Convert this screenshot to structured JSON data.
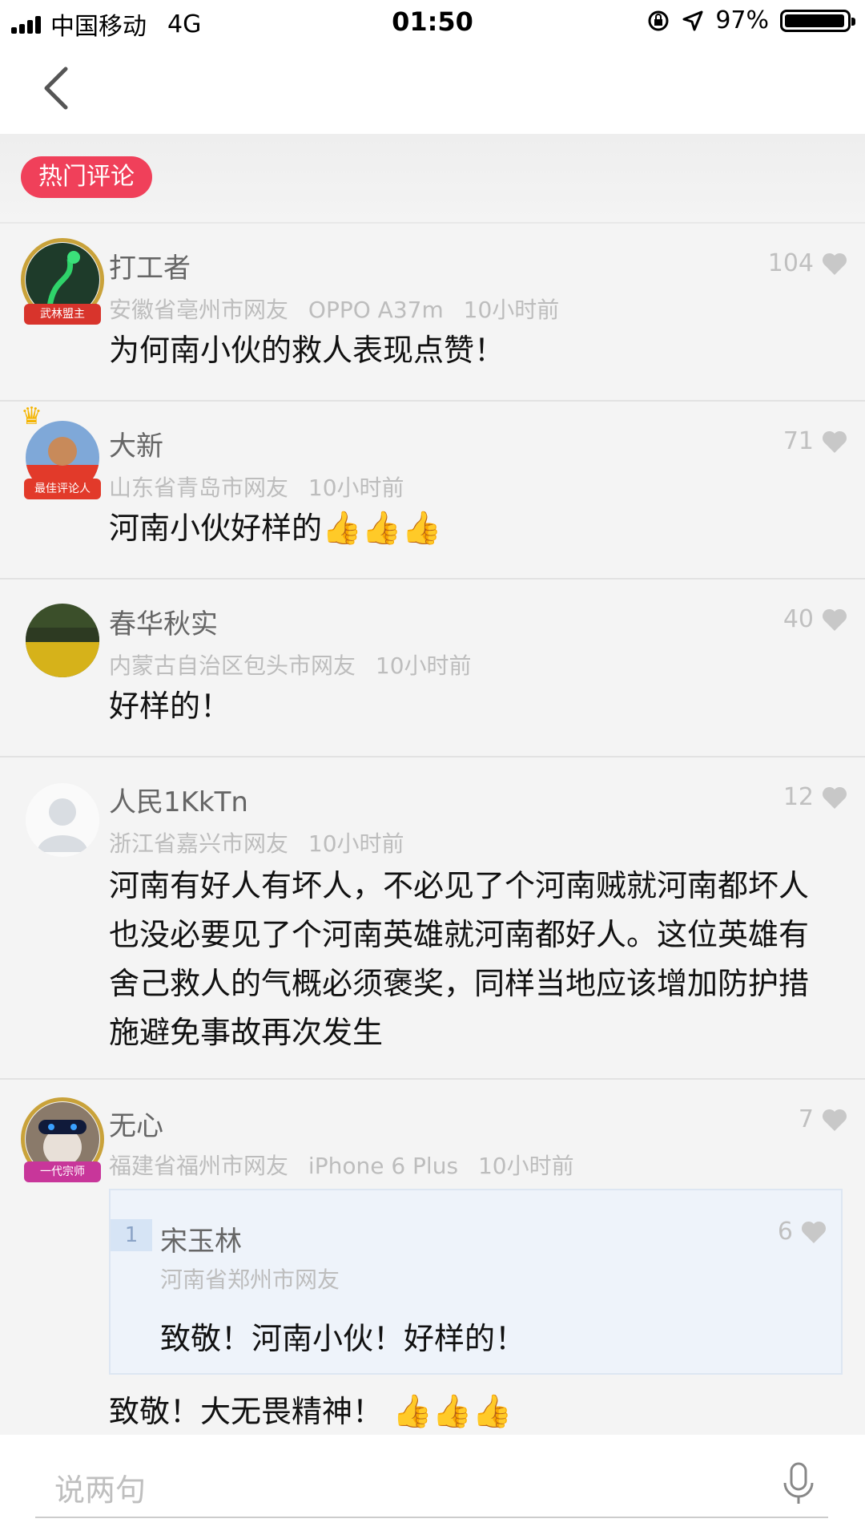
{
  "status_bar": {
    "carrier": "中国移动",
    "network": "4G",
    "time": "01:50",
    "battery": "97%",
    "battery_level": 0.97
  },
  "section": {
    "hot_label": "热门评论"
  },
  "comments": [
    {
      "name": "打工者",
      "location": "安徽省亳州市网友",
      "device": "OPPO A37m",
      "time": "10小时前",
      "likes": "104",
      "text": "为何南小伙的救人表现点赞！",
      "badge": "武林盟主"
    },
    {
      "name": "大新",
      "location": "山东省青岛市网友",
      "time": "10小时前",
      "likes": "71",
      "text": "河南小伙好样的",
      "emoji": "👍👍👍",
      "badge": "最佳评论人"
    },
    {
      "name": "春华秋实",
      "location": "内蒙古自治区包头市网友",
      "time": "10小时前",
      "likes": "40",
      "text": "好样的！"
    },
    {
      "name": "人民1KkTn",
      "location": "浙江省嘉兴市网友",
      "time": "10小时前",
      "likes": "12",
      "text": "河南有好人有坏人，不必见了个河南贼就河南都坏人也没必要见了个河南英雄就河南都好人。这位英雄有舍己救人的气概必须褒奖，同样当地应该增加防护措施避免事故再次发生"
    },
    {
      "name": "无心",
      "location": "福建省福州市网友",
      "device": "iPhone 6 Plus",
      "time": "10小时前",
      "likes": "7",
      "badge": "一代宗师",
      "reply": {
        "index": "1",
        "name": "宋玉林",
        "location": "河南省郑州市网友",
        "likes": "6",
        "text": "致敬！河南小伙！好样的！"
      },
      "text": "致敬！大无畏精神！",
      "emoji": "👍👍👍"
    }
  ],
  "footer": {
    "input_placeholder": "说两句"
  },
  "icons": [
    "back-icon",
    "heart-icon",
    "microphone-icon",
    "location-arrow-icon",
    "rotation-lock-icon",
    "crown-icon"
  ],
  "colors": {
    "accent": "#f0405a",
    "meta_gray": "#bdbdbd",
    "reply_bg": "#eef3fa"
  }
}
